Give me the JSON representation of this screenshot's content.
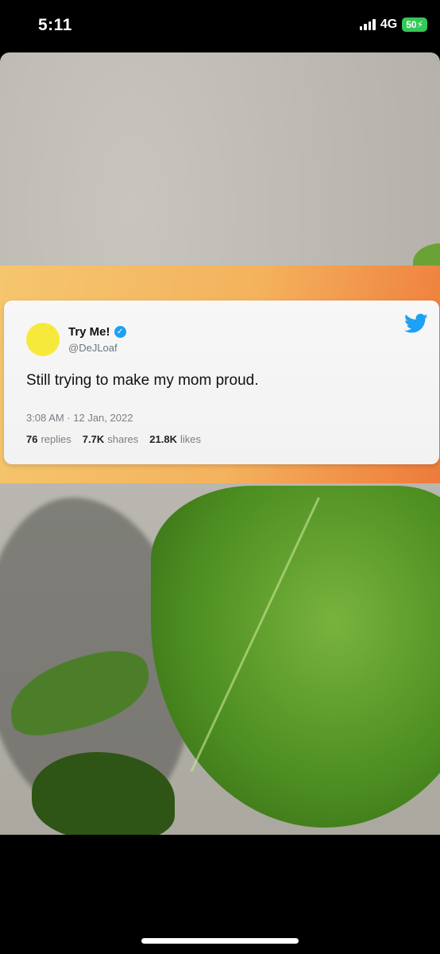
{
  "status_bar": {
    "time": "5:11",
    "network": "4G",
    "battery": "50"
  },
  "tweet": {
    "display_name": "Try Me!",
    "handle": "@DeJLoaf",
    "text": "Still trying to make my mom proud.",
    "timestamp": "3:08 AM · 12 Jan, 2022",
    "replies_count": "76",
    "replies_label": "replies",
    "shares_count": "7.7K",
    "shares_label": "shares",
    "likes_count": "21.8K",
    "likes_label": "likes"
  },
  "colors": {
    "avatar": "#f7e93b",
    "verified": "#1da1f2",
    "banner_start": "#f5c66e",
    "banner_end": "#ee7a3a",
    "battery": "#34c759"
  },
  "icons": {
    "verified": "verified-badge-icon",
    "platform": "twitter-bird-icon",
    "signal": "cellular-signal-icon"
  }
}
